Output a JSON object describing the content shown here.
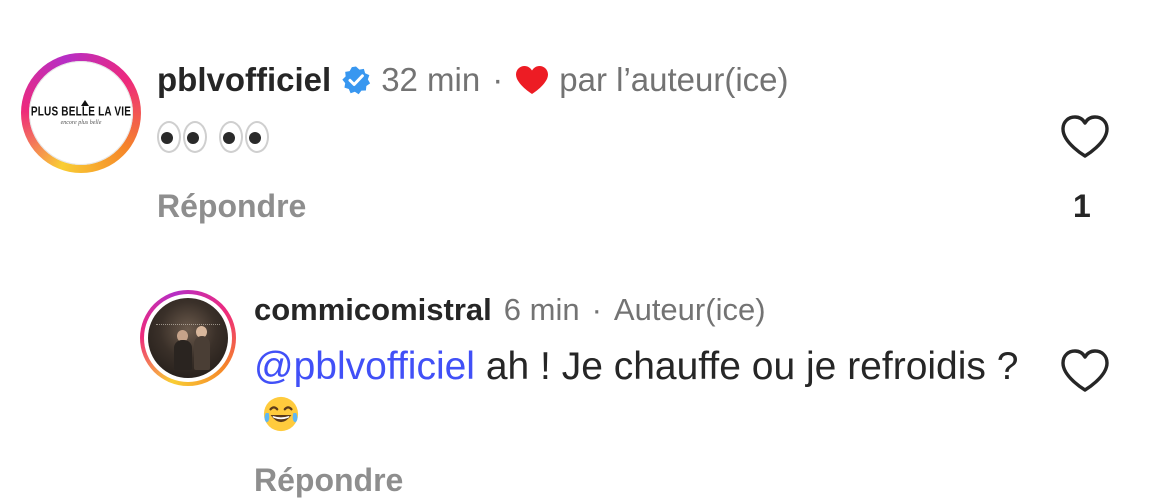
{
  "comments": [
    {
      "username": "pblvofficiel",
      "verified": true,
      "time": "32 min",
      "separator": "·",
      "liked_by_author_label": "par l’auteur(ice)",
      "text_emojis": "👀👀",
      "reply_label": "Répondre",
      "like_count": "1",
      "avatar": {
        "logo_text": "PLUS BELLE LA VIE",
        "logo_subtext": "encore plus belle"
      }
    },
    {
      "username": "commicomistral",
      "time": "6 min",
      "separator": "·",
      "author_label": "Auteur(ice)",
      "mention": "@pblvofficiel",
      "text": " ah ! Je chauffe ou je refroidis ?",
      "emoji": "😂",
      "reply_label": "Répondre"
    }
  ],
  "icons": {
    "verified": "verified-badge-icon",
    "author_heart": "heart-filled-icon",
    "like": "heart-outline-icon"
  },
  "colors": {
    "verified_blue": "#3897f0",
    "heart_red": "#ed1c24",
    "mention_blue": "#4150f7",
    "meta_gray": "#737373",
    "reply_gray": "#8e8e8e"
  }
}
